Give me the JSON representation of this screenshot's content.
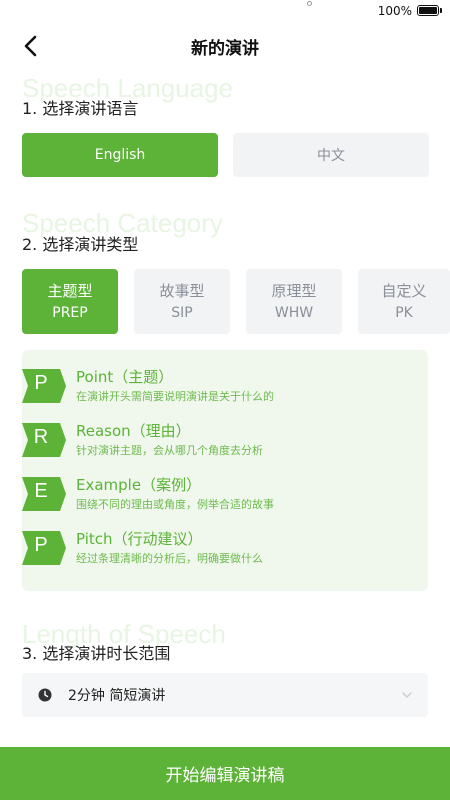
{
  "status": {
    "battery_text": "100%"
  },
  "nav": {
    "title": "新的演讲"
  },
  "sections": {
    "language": {
      "ghost": "Speech Language",
      "title": "1. 选择演讲语言"
    },
    "category": {
      "ghost": "Speech Category",
      "title": "2. 选择演讲类型"
    },
    "length": {
      "ghost": "Length of Speech",
      "title": "3. 选择演讲时长范围"
    }
  },
  "languages": [
    {
      "label": "English",
      "selected": true
    },
    {
      "label": "中文",
      "selected": false
    }
  ],
  "types": [
    {
      "name": "主题型",
      "code": "PREP",
      "selected": true
    },
    {
      "name": "故事型",
      "code": "SIP",
      "selected": false
    },
    {
      "name": "原理型",
      "code": "WHW",
      "selected": false
    },
    {
      "name": "自定义",
      "code": "PK",
      "selected": false
    }
  ],
  "prep_steps": [
    {
      "letter": "P",
      "title": "Point（主题）",
      "desc": "在演讲开头需简要说明演讲是关于什么的"
    },
    {
      "letter": "R",
      "title": "Reason（理由）",
      "desc": "针对演讲主题，会从哪几个角度去分析"
    },
    {
      "letter": "E",
      "title": "Example（案例）",
      "desc": "围绕不同的理由或角度，例举合适的故事"
    },
    {
      "letter": "P",
      "title": "Pitch（行动建议）",
      "desc": "经过条理清晰的分析后，明确要做什么"
    }
  ],
  "duration": {
    "selected": "2分钟 简短演讲"
  },
  "start_button": {
    "label": "开始编辑演讲稿"
  },
  "colors": {
    "brand": "#5cb338",
    "panel": "#f0f8ed",
    "inactive_bg": "#f2f3f5",
    "inactive_text": "#8a8f99"
  }
}
